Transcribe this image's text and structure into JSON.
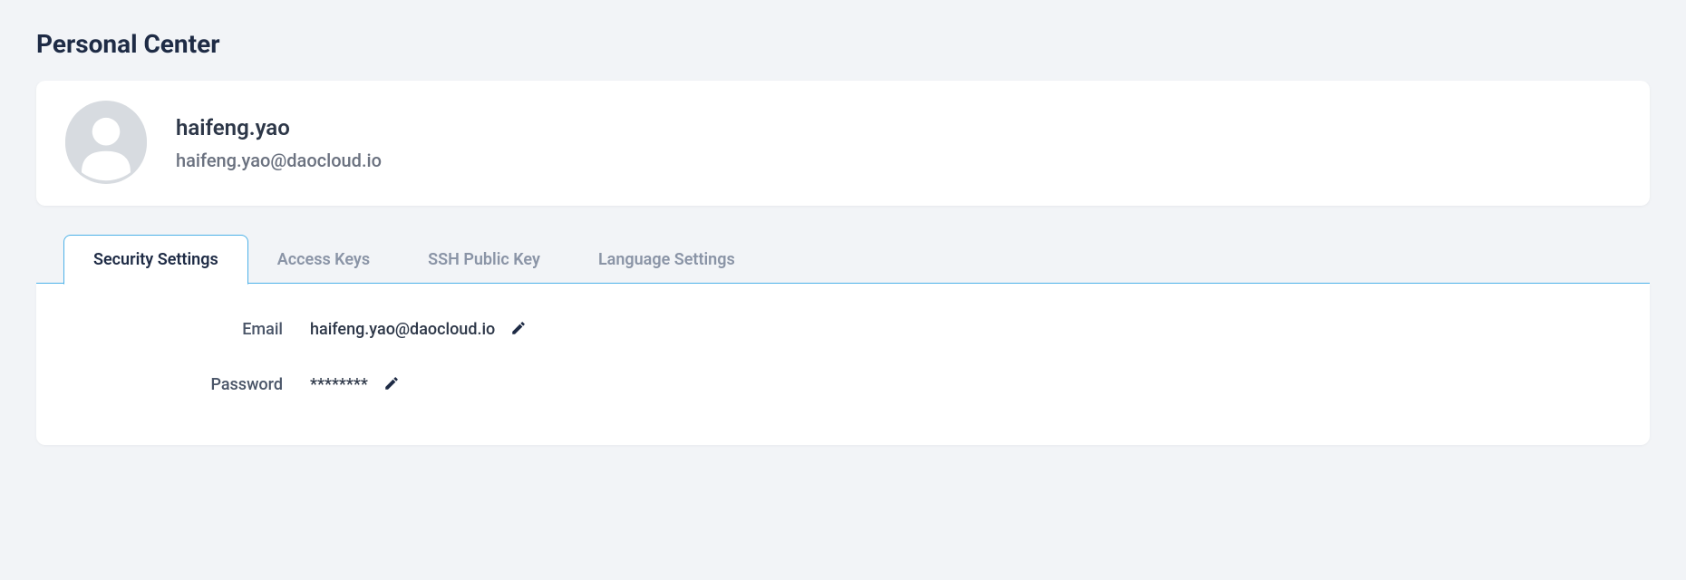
{
  "page": {
    "title": "Personal Center"
  },
  "profile": {
    "name": "haifeng.yao",
    "email": "haifeng.yao@daocloud.io"
  },
  "tabs": [
    {
      "label": "Security Settings",
      "active": true
    },
    {
      "label": "Access Keys",
      "active": false
    },
    {
      "label": "SSH Public Key",
      "active": false
    },
    {
      "label": "Language Settings",
      "active": false
    }
  ],
  "security": {
    "email_label": "Email",
    "email_value": "haifeng.yao@daocloud.io",
    "password_label": "Password",
    "password_value": "********"
  }
}
